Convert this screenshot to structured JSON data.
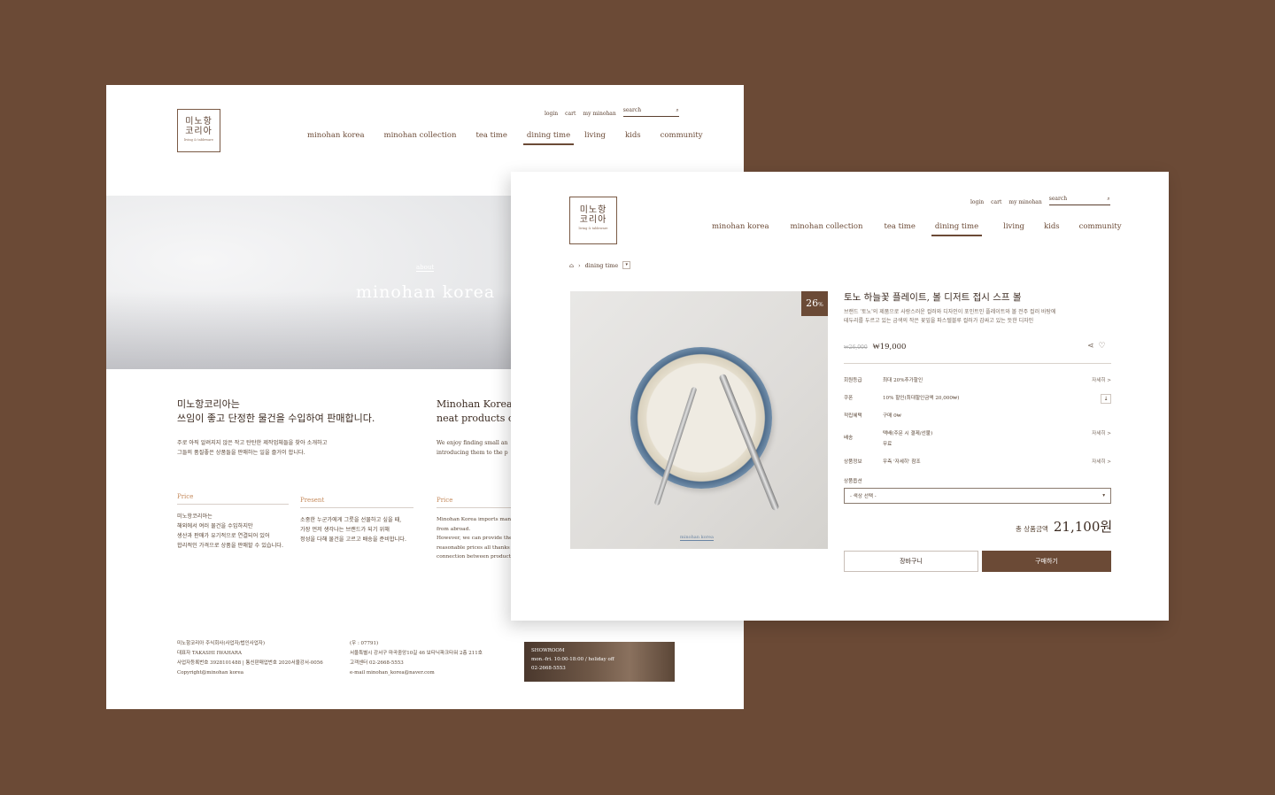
{
  "logo": {
    "line1": "미노항",
    "line2": "코리아",
    "tagline": "living & tableware"
  },
  "utility": {
    "login": "login",
    "cart": "cart",
    "my": "my minohan",
    "search_placeholder": "search"
  },
  "nav": [
    "minohan korea",
    "minohan collection",
    "tea time",
    "dining time",
    "living",
    "kids",
    "community"
  ],
  "nav_active": "dining time",
  "about_page": {
    "hero_sub": "about",
    "hero_title": "minohan korea",
    "ko_heading_1": "미노항코리아는",
    "ko_heading_2": "쓰임이 좋고 단정한 물건을 수입하여 판매합니다.",
    "ko_body_1": "주로 아직 알려지지 않은 작고 탄탄한 제작업체들을 찾아 소개하고",
    "ko_body_2": "그들의 품질좋은 상품들을 판매하는 일을 즐거이 합니다.",
    "en_heading_1": "Minohan Korea i",
    "en_heading_2": "neat products of g",
    "en_body_1": "We enjoy finding small an",
    "en_body_2": "introducing them to the p",
    "col1": {
      "label": "Price",
      "lines": [
        "미노항코리아는",
        "해외에서 여러 물건을 수입하지만",
        "생산과 판매가 유기적으로 연결되어 있어",
        "합리적인 가격으로 상품을 판매할 수 있습니다."
      ]
    },
    "col2": {
      "label": "Present",
      "lines": [
        "소중한 누군가에게 그릇을 선물하고 싶을 때,",
        "가장 먼저 생각나는 브랜드가 되기 위해",
        "정성을 다해 물건을 고르고 배송을 준비합니다."
      ]
    },
    "col3": {
      "label": "Price",
      "lines": [
        "Minohan Korea imports many t",
        "from abroad.",
        "However, we can provide these",
        "reasonable prices all thanks to t",
        "connection between production"
      ]
    },
    "footer_left": [
      "미노항코리아 주식회사(사업자/법인사업자)",
      "대표자 TAKASHI IWAHARA",
      "사업자등록번호 3928101488 | 통신판매업번호 2020서울강서-0056",
      "Copyright@minohan korea"
    ],
    "footer_mid": [
      "(우 : 07791)",
      "서울특별시 강서구 마곡중앙10길 46 보타닉파크타워 2층 211호",
      "고객센터 02-2668-5553",
      "e-mail minohan_korea@naver.com"
    ],
    "showroom": [
      "SHOWROOM",
      "mon.-fri. 10:00-18:00 / holiday off",
      "02-2668-5553"
    ]
  },
  "product_page": {
    "breadcrumb": "dining time",
    "badge_value": "26",
    "badge_unit": "%",
    "photo_caption": "minohan korea",
    "title": "토노 하늘꽃 플레이트, 볼 디저트 접시 스프 볼",
    "desc_1": "브랜드 '토노'의 제품으로 사랑스러운 컬러와 디자인이 포인트인 플레이트와 볼 전주 컬러 바탕에",
    "desc_2": "테두리를 두르고 있는 금색의 작은 꽃잎을 파스텔블루 컬러가 감싸고 있는 듯한 디자인",
    "price_old": "₩26,000",
    "price_now": "₩19,000",
    "rows": [
      {
        "k": "회원등급",
        "v": "최대 20%추가할인",
        "more": "자세히 >"
      },
      {
        "k": "쿠폰",
        "v": "10% 할인(최대할인금액 20,000₩)",
        "more": "⤓"
      },
      {
        "k": "적립혜택",
        "v": "구매 0₩",
        "more": ""
      },
      {
        "k": "배송",
        "v": "택배(주문 시 결제/선불)",
        "v2": "무료",
        "more": "자세히 >"
      },
      {
        "k": "상품정보",
        "v": "우측 '자세히' 참조",
        "more": "자세히 >"
      }
    ],
    "option_label": "상품옵션",
    "option_value": "- 색상 선택 -",
    "total_label": "총 상품금액",
    "total_value": "21,100원",
    "cart_button": "장바구니",
    "buy_button": "구매하기"
  },
  "colors": {
    "background": "#6b4a36",
    "accent": "#6b4a36",
    "label": "#c58a5c"
  }
}
